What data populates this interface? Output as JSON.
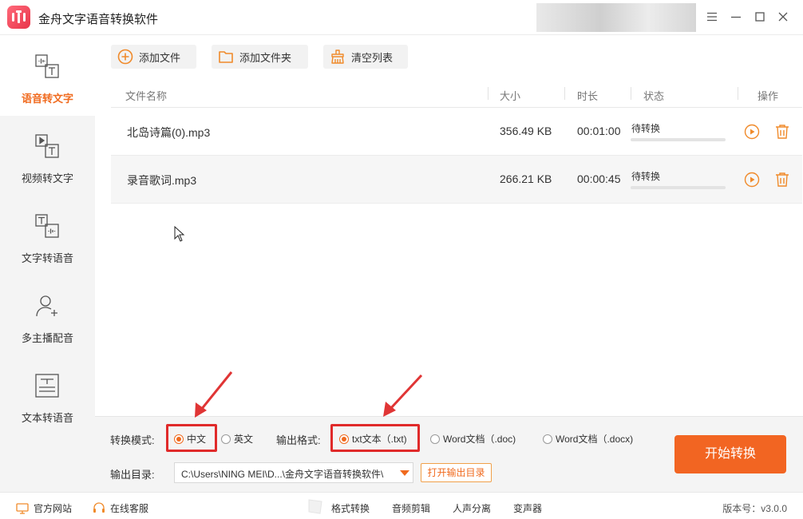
{
  "window": {
    "title": "金舟文字语音转换软件",
    "accent_color": "#f06a1e"
  },
  "sidebar": {
    "items": [
      {
        "label": "语音转文字",
        "icon": "audio-to-text-icon",
        "active": true
      },
      {
        "label": "视频转文字",
        "icon": "video-to-text-icon",
        "active": false
      },
      {
        "label": "文字转语音",
        "icon": "text-to-audio-icon",
        "active": false
      },
      {
        "label": "多主播配音",
        "icon": "multi-voice-icon",
        "active": false
      },
      {
        "label": "文本转语音",
        "icon": "document-to-audio-icon",
        "active": false
      }
    ]
  },
  "toolbar": {
    "add_file": "添加文件",
    "add_folder": "添加文件夹",
    "clear_list": "清空列表"
  },
  "table": {
    "headers": {
      "name": "文件名称",
      "size": "大小",
      "duration": "时长",
      "status": "状态",
      "actions": "操作"
    },
    "rows": [
      {
        "name": "北岛诗篇(0).mp3",
        "size": "356.49 KB",
        "duration": "00:01:00",
        "status": "待转换",
        "progress": 0
      },
      {
        "name": "录音歌词.mp3",
        "size": "266.21 KB",
        "duration": "00:00:45",
        "status": "待转换",
        "progress": 0
      }
    ]
  },
  "settings": {
    "mode_label": "转换模式:",
    "mode_options": [
      "中文",
      "英文"
    ],
    "mode_selected": "中文",
    "format_label": "输出格式:",
    "format_options": [
      "txt文本（.txt)",
      "Word文档（.doc)",
      "Word文档（.docx)"
    ],
    "format_selected": "txt文本（.txt)",
    "output_dir_label": "输出目录:",
    "output_dir_value": "C:\\Users\\NING MEI\\D...\\金舟文字语音转换软件\\",
    "open_dir_button": "打开输出目录",
    "start_button": "开始转换"
  },
  "footer": {
    "website": "官方网站",
    "support": "在线客服",
    "links": [
      "格式转换",
      "音频剪辑",
      "人声分离",
      "变声器"
    ],
    "version": "版本号：v3.0.0"
  }
}
